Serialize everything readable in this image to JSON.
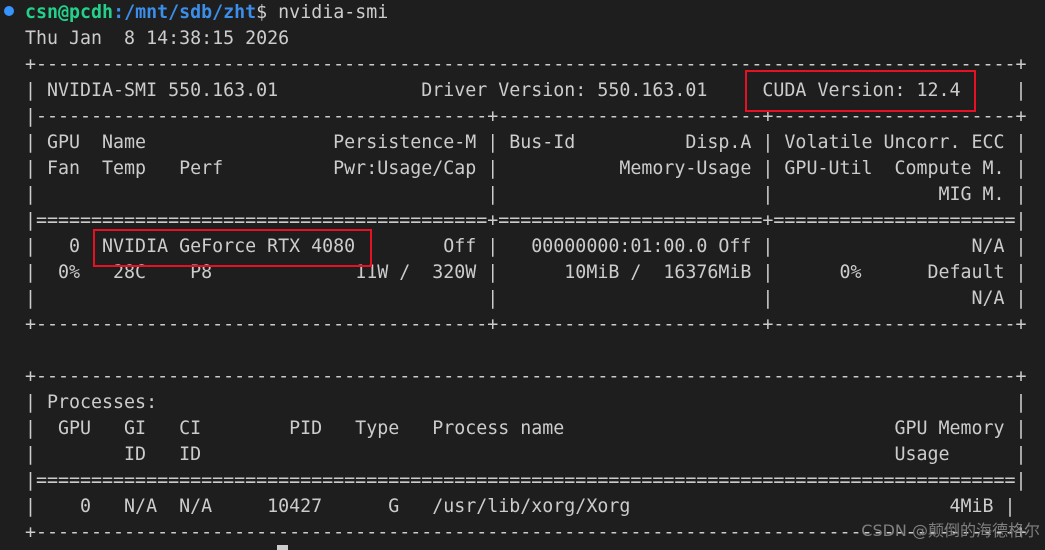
{
  "prompt": {
    "user_host": "csn@pcdh",
    "path": ":/mnt/sdb/zht",
    "symbol": "$",
    "command": " nvidia-smi"
  },
  "output": {
    "timestamp": "Thu Jan  8 14:38:15 2026",
    "border_top": "+-----------------------------------------------------------------------------------------+",
    "header_row": "| NVIDIA-SMI 550.163.01             Driver Version: 550.163.01     CUDA Version: 12.4     |",
    "divider_1": "|-----------------------------------------+------------------------+----------------------+",
    "col_header_1": "| GPU  Name                 Persistence-M | Bus-Id          Disp.A | Volatile Uncorr. ECC |",
    "col_header_2": "| Fan  Temp   Perf          Pwr:Usage/Cap |           Memory-Usage | GPU-Util  Compute M. |",
    "col_header_3": "|                                         |                        |               MIG M. |",
    "divider_2": "|=========================================+========================+======================|",
    "gpu_row_1": "|   0  NVIDIA GeForce RTX 4080        Off |   00000000:01:00.0 Off |                  N/A |",
    "gpu_row_2": "|  0%   28C    P8             11W /  320W |      10MiB /  16376MiB |      0%      Default |",
    "gpu_row_3": "|                                         |                        |                  N/A |",
    "border_bottom": "+-----------------------------------------+------------------------+----------------------+",
    "proc_border_top": "+-----------------------------------------------------------------------------------------+",
    "proc_title": "| Processes:                                                                              |",
    "proc_header_1": "|  GPU   GI   CI        PID   Type   Process name                              GPU Memory |",
    "proc_header_2": "|        ID   ID                                                               Usage      |",
    "proc_divider": "|=========================================================================================|",
    "proc_row_1": "|    0   N/A  N/A     10427      G   /usr/lib/xorg/Xorg                             4MiB |",
    "proc_border_bottom": "+-----------------------------------------------------------------------------------------+"
  },
  "watermark": "CSDN @颠倒的海德格尔",
  "colors": {
    "background": "#1e1e1e",
    "text": "#cccccc",
    "user_host": "#23d18b",
    "path": "#3b8eea",
    "highlight_box": "#e81123"
  }
}
